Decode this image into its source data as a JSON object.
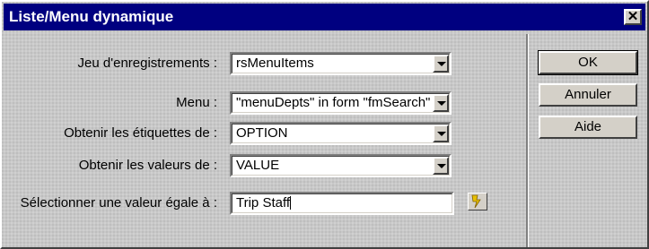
{
  "window": {
    "title": "Liste/Menu dynamique",
    "close_glyph": "✕"
  },
  "form": {
    "recordset": {
      "label": "Jeu d'enregistrements :",
      "value": "rsMenuItems"
    },
    "menu": {
      "label": "Menu :",
      "value": "\"menuDepts\" in form \"fmSearch\""
    },
    "labels_from": {
      "label": "Obtenir les étiquettes de :",
      "value": "OPTION"
    },
    "values_from": {
      "label": "Obtenir les valeurs de :",
      "value": "VALUE"
    },
    "select_value": {
      "label": "Sélectionner une valeur égale à :",
      "value": "Trip Staff"
    }
  },
  "buttons": {
    "ok": "OK",
    "cancel": "Annuler",
    "help": "Aide"
  },
  "icons": {
    "dynamic_data": "lightning-bolt-icon"
  },
  "colors": {
    "titlebar": "#000080",
    "dialog_bg": "#c8c8c8",
    "bolt": "#e8c000"
  }
}
